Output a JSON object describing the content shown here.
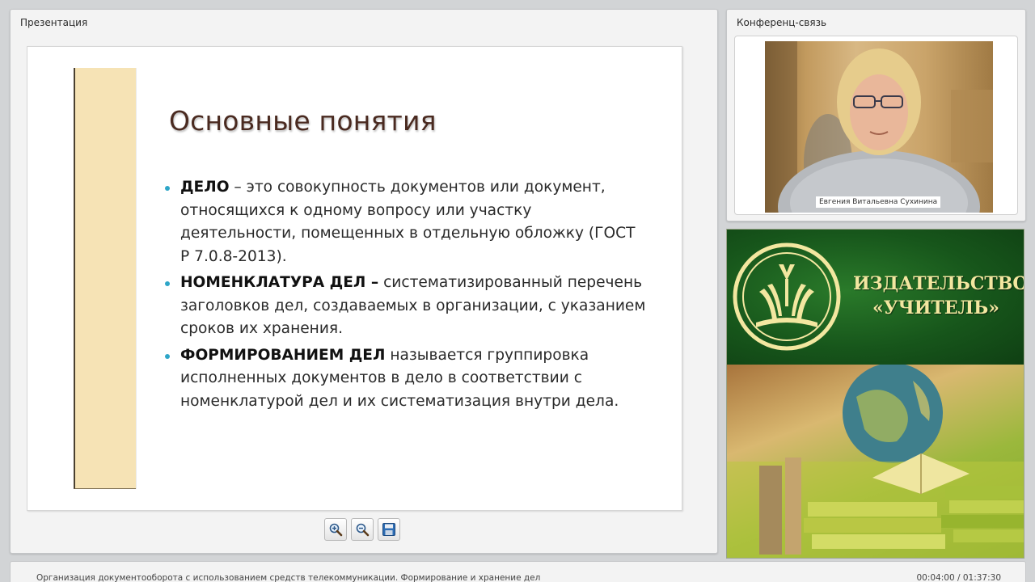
{
  "presentation": {
    "panel_title": "Презентация",
    "slide": {
      "title": "Основные понятия",
      "items": [
        {
          "term": "ДЕЛО",
          "text": " – это совокупность документов или документ, относящихся к одному вопросу или участку деятельности, помещенных в отдельную обложку (ГОСТ Р 7.0.8-2013)."
        },
        {
          "term": "НОМЕНКЛАТУРА ДЕЛ –",
          "text": " систематизированный перечень заголовков дел, создаваемых в организации, с указанием сроков их хранения."
        },
        {
          "term": "ФОРМИРОВАНИЕМ ДЕЛ",
          "text": " называется группировка исполненных документов в дело в соответствии с номенклатурой дел и их систематизация внутри дела."
        }
      ]
    },
    "toolbar": [
      {
        "name": "zoom-in",
        "icon": "zoom-in-icon"
      },
      {
        "name": "zoom-out",
        "icon": "zoom-out-icon"
      },
      {
        "name": "save",
        "icon": "floppy-disk-icon"
      }
    ]
  },
  "conference": {
    "panel_title": "Конференц-связь",
    "participant_name": "Евгения Витальевна Сухинина"
  },
  "ad": {
    "line1": "ИЗДАТЕЛЬСТВО",
    "line2": "«УЧИТЕЛЬ»"
  },
  "status": {
    "course_title": "Организация документооборота с использованием средств телекоммуникации. Формирование и хранение дел",
    "time": "00:04:00 / 01:37:30"
  },
  "colors": {
    "slide_bar": "#f6e3b5",
    "slide_title": "#4a2a20",
    "bullet": "#2ea6c8",
    "ad_green": "#17561b",
    "ad_text": "#f3e7a0"
  }
}
